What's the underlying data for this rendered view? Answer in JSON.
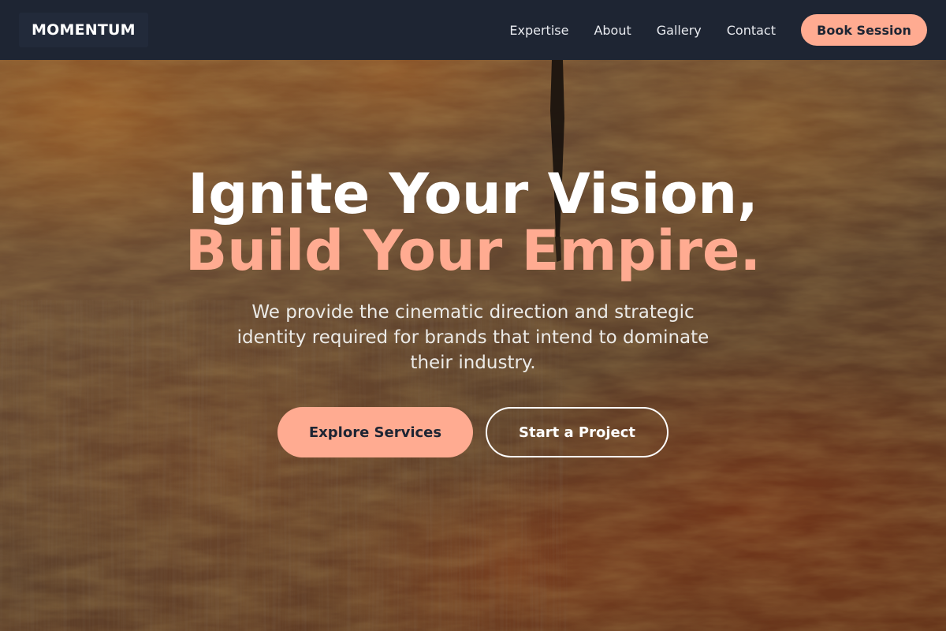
{
  "brand": {
    "logo": "MOMENTUM"
  },
  "nav": {
    "links": [
      "Expertise",
      "About",
      "Gallery",
      "Contact"
    ],
    "book_label": "Book Session"
  },
  "hero": {
    "headline_line1": "Ignite Your Vision,",
    "headline_line2": "Build Your Empire.",
    "subtitle": "We provide the cinematic direction and strategic identity required for brands that intend to dominate their industry.",
    "primary_cta": "Explore Services",
    "secondary_cta": "Start a Project"
  },
  "colors": {
    "nav_bg": "#1e2533",
    "accent": "#ffab91",
    "headline_white": "#ffffff"
  }
}
